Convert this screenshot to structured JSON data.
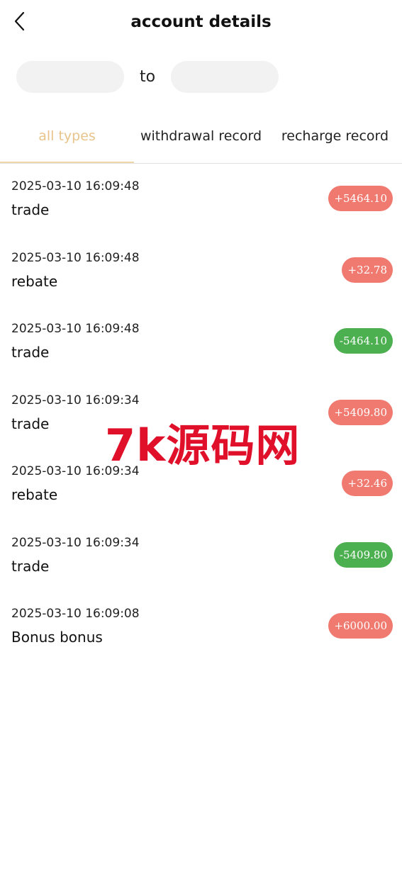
{
  "header": {
    "title": "account details",
    "back_icon": "chevron-left-icon"
  },
  "date_range": {
    "start_value": "",
    "end_value": "",
    "separator": "to"
  },
  "tabs": [
    {
      "label": "all types",
      "active": true
    },
    {
      "label": "withdrawal record",
      "active": false
    },
    {
      "label": "recharge record",
      "active": false
    }
  ],
  "records": [
    {
      "time": "2025-03-10 16:09:48",
      "type": "trade",
      "amount": "+5464.10",
      "direction": "in"
    },
    {
      "time": "2025-03-10 16:09:48",
      "type": "rebate",
      "amount": "+32.78",
      "direction": "in"
    },
    {
      "time": "2025-03-10 16:09:48",
      "type": "trade",
      "amount": "-5464.10",
      "direction": "out"
    },
    {
      "time": "2025-03-10 16:09:34",
      "type": "trade",
      "amount": "+5409.80",
      "direction": "in"
    },
    {
      "time": "2025-03-10 16:09:34",
      "type": "rebate",
      "amount": "+32.46",
      "direction": "in"
    },
    {
      "time": "2025-03-10 16:09:34",
      "type": "trade",
      "amount": "-5409.80",
      "direction": "out"
    },
    {
      "time": "2025-03-10 16:09:08",
      "type": "Bonus bonus",
      "amount": "+6000.00",
      "direction": "in"
    }
  ],
  "colors": {
    "active_tab": "#e8c48a",
    "positive_badge": "#f07a70",
    "negative_badge": "#4caf50",
    "input_bg": "#f2f2f2"
  },
  "watermark": {
    "text": "7k源码网"
  }
}
